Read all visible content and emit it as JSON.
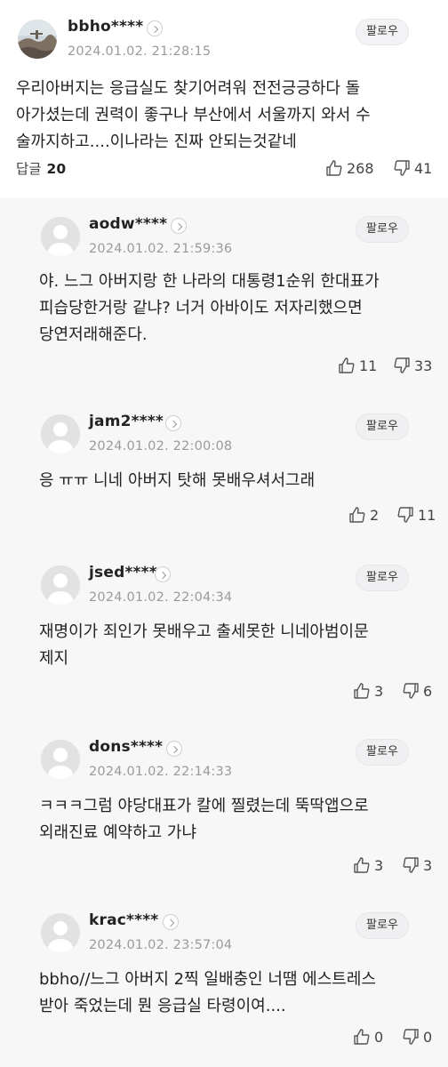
{
  "main_comment": {
    "username": "bbho****",
    "date": "2024.01.02. 21:28:15",
    "follow_label": "팔로우",
    "text": "우리아버지는 응급실도 찾기어려워 전전긍긍하다 돌\n아가셨는데 권력이 좋구나 부산에서 서울까지 와서 수\n술까지하고....이나라는 진짜 안되는것같네",
    "reply_label": "답글",
    "reply_count": "20",
    "likes": "268",
    "dislikes": "41"
  },
  "replies": [
    {
      "username": "aodw****",
      "date": "2024.01.02. 21:59:36",
      "follow_label": "팔로우",
      "text": "야. 느그 아버지랑 한 나라의 대통령1순위 한대표가\n피습당한거랑 같냐? 너거 아바이도 저자리했으면\n당연저래해준다.",
      "likes": "11",
      "dislikes": "33"
    },
    {
      "username": "jam2****",
      "date": "2024.01.02. 22:00:08",
      "follow_label": "팔로우",
      "text": "응 ㅠㅠ 니네 아버지 탓해 못배우셔서그래",
      "likes": "2",
      "dislikes": "11"
    },
    {
      "username": "jsed****",
      "date": "2024.01.02. 22:04:34",
      "follow_label": "팔로우",
      "text": "재명이가 죄인가 못배우고 출세못한 니네아범이문\n제지",
      "likes": "3",
      "dislikes": "6"
    },
    {
      "username": "dons****",
      "date": "2024.01.02. 22:14:33",
      "follow_label": "팔로우",
      "text": "ㅋㅋㅋ그럼 야당대표가 칼에 찔렸는데 뚝딱앱으로\n외래진료 예약하고 가냐",
      "likes": "3",
      "dislikes": "3"
    },
    {
      "username": "krac****",
      "date": "2024.01.02. 23:57:04",
      "follow_label": "팔로우",
      "text": "bbho//느그 아버지 2찍 일배충인 너땜 에스트레스\n받아 죽었는데 뭔 응급실 타령이여....",
      "likes": "0",
      "dislikes": "0"
    }
  ]
}
